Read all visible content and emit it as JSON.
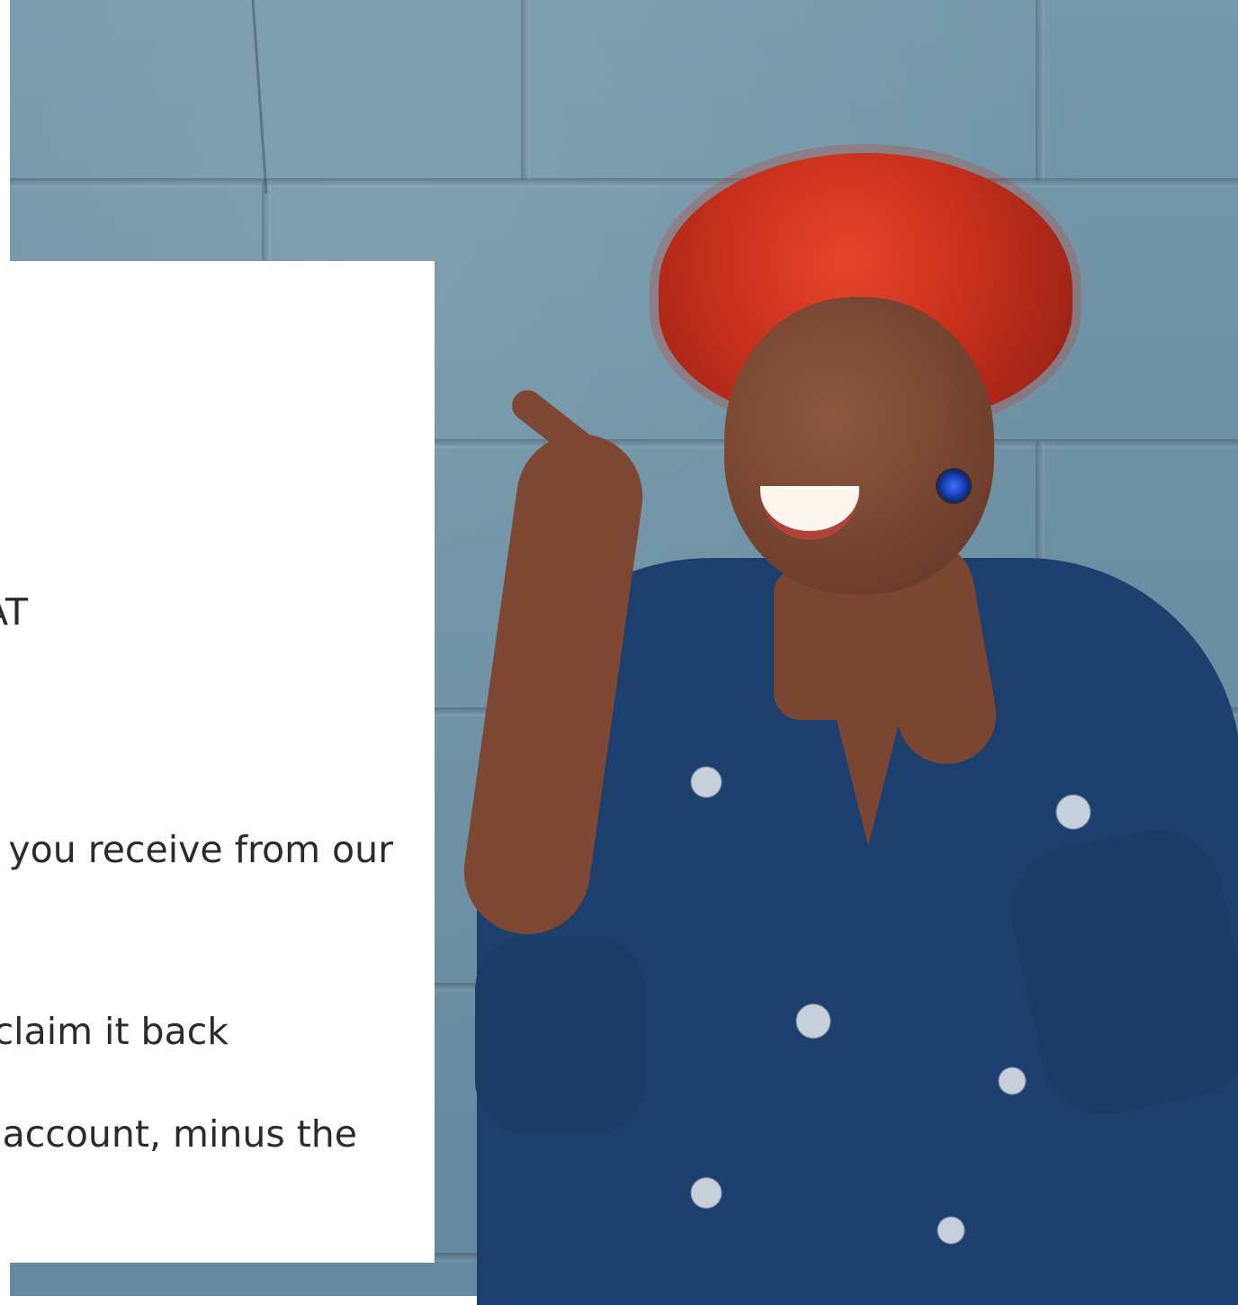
{
  "hero": {
    "image_icon": "woman-smiling-pointing-photo-icon"
  },
  "card": {
    "fragments": [
      "AT",
      "you receive from our",
      "claim it back",
      "account, minus the"
    ]
  },
  "colors": {
    "wall": "#6a8ea0",
    "card": "#ffffff",
    "text": "#2b2b2b",
    "hair": "#c8301d",
    "dress": "#1d3f6d"
  }
}
